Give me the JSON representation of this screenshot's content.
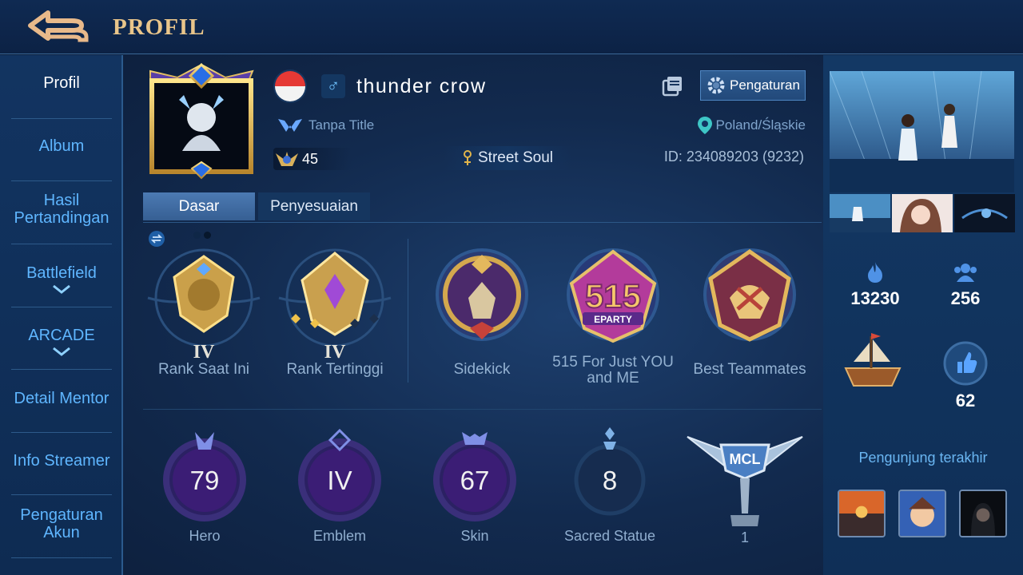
{
  "header": {
    "title": "PROFIL"
  },
  "sidebar": {
    "items": [
      {
        "label": "Profil",
        "active": true
      },
      {
        "label": "Album"
      },
      {
        "label": "Hasil\nPertandingan"
      },
      {
        "label": "Battlefield",
        "expandable": true
      },
      {
        "label": "ARCADE",
        "expandable": true
      },
      {
        "label": "Detail Mentor"
      },
      {
        "label": "Info Streamer"
      },
      {
        "label": "Pengaturan\nAkun"
      }
    ]
  },
  "profile": {
    "name": "thunder crow",
    "gender_icon": "♂",
    "title": "Tanpa Title",
    "level": "45",
    "squad": "Street Soul",
    "id_text": "ID: 234089203 (9232)",
    "location": "Poland/Śląskie",
    "settings_label": "Pengaturan"
  },
  "tabs": [
    {
      "label": "Dasar",
      "active": true
    },
    {
      "label": "Penyesuaian"
    }
  ],
  "badges": [
    {
      "label": "Rank Saat Ini",
      "tier": "IV"
    },
    {
      "label": "Rank Tertinggi",
      "tier": "IV"
    },
    {
      "label": "Sidekick"
    },
    {
      "label": "515 For Just YOU and ME",
      "emblem_text": "515",
      "emblem_sub": "EPARTY"
    },
    {
      "label": "Best Teammates"
    }
  ],
  "stats": [
    {
      "label": "Hero",
      "value": "79"
    },
    {
      "label": "Emblem",
      "value": "IV"
    },
    {
      "label": "Skin",
      "value": "67"
    },
    {
      "label": "Sacred Statue",
      "value": "8"
    },
    {
      "label": "1",
      "emblem_text": "MCL"
    }
  ],
  "right": {
    "popularity": "13230",
    "followers": "256",
    "likes": "62",
    "visitors_title": "Pengunjung terakhir"
  },
  "colors": {
    "accent_blue": "#5fb6ff",
    "gold": "#e9c58a",
    "purple_ring": "#7b3fc9"
  }
}
